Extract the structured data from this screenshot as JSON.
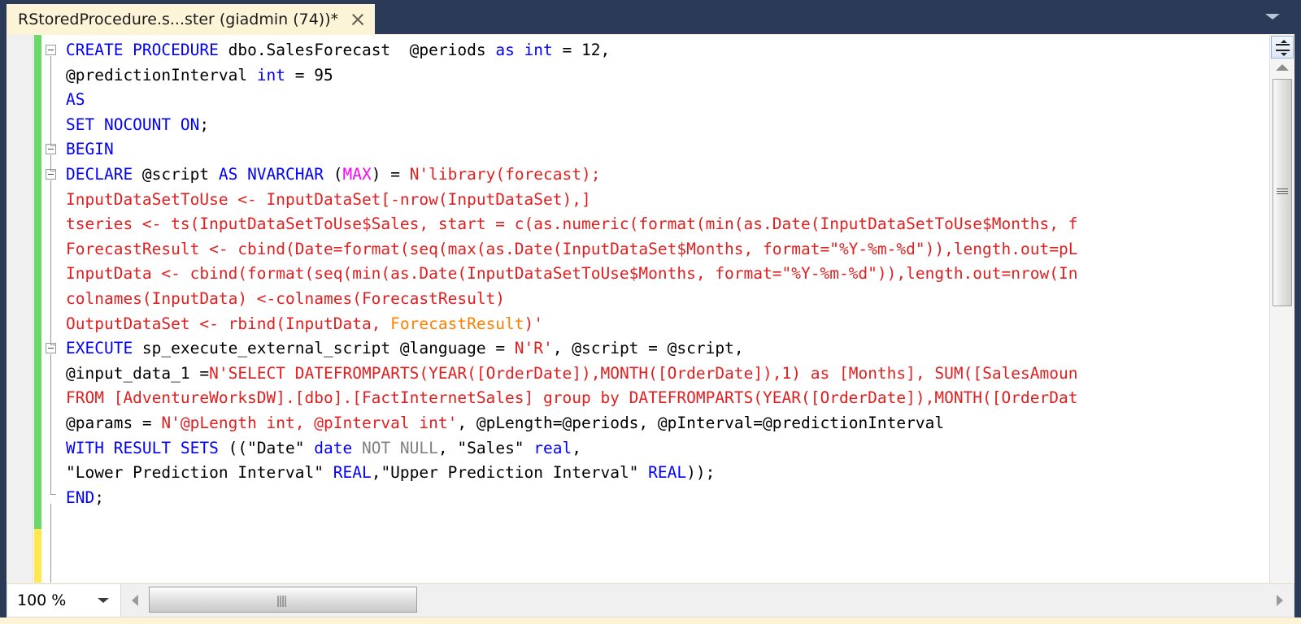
{
  "window": {
    "tab_title": "RStoredProcedure.s...ster (giadmin (74))*",
    "close_icon": "close-icon",
    "overflow_icon": "chevron-down-icon"
  },
  "editor": {
    "language": "T-SQL",
    "change_bar_saved_color": "#6ad96a",
    "change_bar_unsaved_color": "#ffe74d",
    "lines": [
      {
        "n": 1,
        "collapse": true,
        "tokens": [
          {
            "t": "CREATE PROCEDURE ",
            "c": "kw"
          },
          {
            "t": "dbo.SalesForecast  ",
            "c": "plain"
          },
          {
            "t": "@periods ",
            "c": "plain"
          },
          {
            "t": "as int ",
            "c": "kw"
          },
          {
            "t": "= ",
            "c": "plain"
          },
          {
            "t": "12",
            "c": "plain"
          },
          {
            "t": ",",
            "c": "plain"
          }
        ]
      },
      {
        "n": 2,
        "collapse": false,
        "tokens": [
          {
            "t": "@predictionInterval ",
            "c": "plain"
          },
          {
            "t": "int ",
            "c": "kw"
          },
          {
            "t": "= 95",
            "c": "plain"
          }
        ]
      },
      {
        "n": 3,
        "collapse": false,
        "tokens": [
          {
            "t": "AS",
            "c": "kw"
          }
        ]
      },
      {
        "n": 4,
        "collapse": false,
        "tokens": [
          {
            "t": "SET NOCOUNT ON",
            "c": "kw"
          },
          {
            "t": ";",
            "c": "plain"
          }
        ]
      },
      {
        "n": 5,
        "collapse": true,
        "tokens": [
          {
            "t": "BEGIN",
            "c": "kw"
          }
        ]
      },
      {
        "n": 6,
        "collapse": true,
        "tokens": [
          {
            "t": "DECLARE ",
            "c": "kw"
          },
          {
            "t": "@script ",
            "c": "plain"
          },
          {
            "t": "AS NVARCHAR ",
            "c": "kw"
          },
          {
            "t": "(",
            "c": "plain"
          },
          {
            "t": "MAX",
            "c": "pink"
          },
          {
            "t": ") = ",
            "c": "plain"
          },
          {
            "t": "N'library(forecast);",
            "c": "str"
          }
        ]
      },
      {
        "n": 7,
        "collapse": false,
        "tokens": [
          {
            "t": "InputDataSetToUse <- InputDataSet[-nrow(InputDataSet),]",
            "c": "str"
          }
        ]
      },
      {
        "n": 8,
        "collapse": false,
        "tokens": [
          {
            "t": "tseries <- ts(InputDataSetToUse$Sales, start = c(as.numeric(format(min(as.Date(InputDataSetToUse$Months, f",
            "c": "str"
          }
        ]
      },
      {
        "n": 9,
        "collapse": false,
        "tokens": [
          {
            "t": "ForecastResult <- cbind(Date=format(seq(max(as.Date(InputDataSet$Months, format=\"%Y-%m-%d\")),length.out=pL",
            "c": "str"
          }
        ]
      },
      {
        "n": 10,
        "collapse": false,
        "tokens": [
          {
            "t": "InputData <- cbind(format(seq(min(as.Date(InputDataSetToUse$Months, format=\"%Y-%m-%d\")),length.out=nrow(In",
            "c": "str"
          }
        ]
      },
      {
        "n": 11,
        "collapse": false,
        "tokens": [
          {
            "t": "colnames(InputData) <-colnames(ForecastResult)",
            "c": "str"
          }
        ]
      },
      {
        "n": 12,
        "collapse": false,
        "tokens": [
          {
            "t": "OutputDataSet <- rbind(InputData, ",
            "c": "str"
          },
          {
            "t": "ForecastResult",
            "c": "fn"
          },
          {
            "t": ")'",
            "c": "str"
          }
        ]
      },
      {
        "n": 13,
        "collapse": true,
        "tokens": [
          {
            "t": "EXECUTE ",
            "c": "kw"
          },
          {
            "t": "sp_execute_external_script ",
            "c": "plain"
          },
          {
            "t": "@language ",
            "c": "plain"
          },
          {
            "t": "= ",
            "c": "plain"
          },
          {
            "t": "N'R'",
            "c": "str"
          },
          {
            "t": ", @script = @script,",
            "c": "plain"
          }
        ]
      },
      {
        "n": 14,
        "collapse": false,
        "tokens": [
          {
            "t": "@input_data_1 ",
            "c": "plain"
          },
          {
            "t": "=",
            "c": "plain"
          },
          {
            "t": "N'SELECT ",
            "c": "str"
          },
          {
            "t": "DATEFROMPARTS(YEAR([OrderDate]),MONTH([OrderDate]),1) as [Months], SUM([SalesAmoun",
            "c": "str"
          }
        ]
      },
      {
        "n": 15,
        "collapse": false,
        "tokens": [
          {
            "t": "FROM [AdventureWorksDW].[dbo].[FactInternetSales] group by DATEFROMPARTS(YEAR([OrderDate]),MONTH([OrderDat",
            "c": "str"
          }
        ]
      },
      {
        "n": 16,
        "collapse": false,
        "tokens": [
          {
            "t": "@params ",
            "c": "plain"
          },
          {
            "t": "= ",
            "c": "plain"
          },
          {
            "t": "N'@pLength int, @pInterval int'",
            "c": "str"
          },
          {
            "t": ", @pLength=@periods, @pInterval=@predictionInterval",
            "c": "plain"
          }
        ]
      },
      {
        "n": 17,
        "collapse": false,
        "tokens": [
          {
            "t": "WITH RESULT SETS ",
            "c": "kw"
          },
          {
            "t": "((\"Date\" ",
            "c": "plain"
          },
          {
            "t": "date ",
            "c": "kw"
          },
          {
            "t": "NOT NULL",
            "c": "gray"
          },
          {
            "t": ", \"Sales\" ",
            "c": "plain"
          },
          {
            "t": "real",
            "c": "kw"
          },
          {
            "t": ",",
            "c": "plain"
          }
        ]
      },
      {
        "n": 18,
        "collapse": false,
        "tokens": [
          {
            "t": "\"Lower Prediction Interval\" ",
            "c": "plain"
          },
          {
            "t": "REAL",
            "c": "kw"
          },
          {
            "t": ",\"Upper Prediction Interval\" ",
            "c": "plain"
          },
          {
            "t": "REAL",
            "c": "kw"
          },
          {
            "t": "));",
            "c": "plain"
          }
        ]
      },
      {
        "n": 19,
        "collapse": false,
        "tokens": [
          {
            "t": "END",
            "c": "kw"
          },
          {
            "t": ";",
            "c": "plain"
          }
        ]
      }
    ]
  },
  "vertical_scrollbar": {
    "split_icon": "split-editor-icon",
    "up_arrow_icon": "chevron-up-icon",
    "thumb_icon": "scroll-thumb-grip"
  },
  "bottombar": {
    "zoom_value": "100 %",
    "zoom_caret_icon": "chevron-down-icon",
    "left_arrow_icon": "arrow-left-icon",
    "right_arrow_icon": "arrow-right-icon",
    "hthumb_icon": "scroll-thumb-grip"
  }
}
